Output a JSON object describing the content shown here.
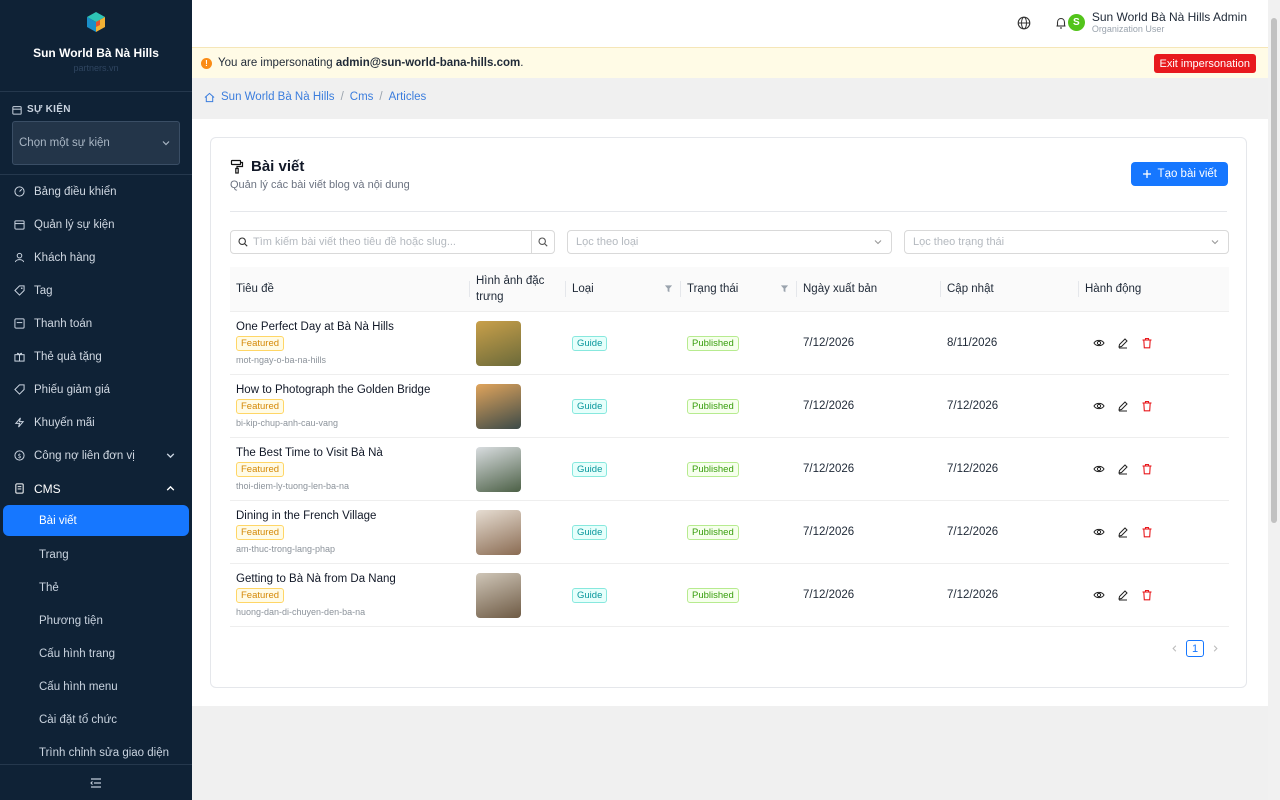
{
  "sidebar": {
    "org_name": "Sun World Bà Nà Hills",
    "org_sub": "partners.vn",
    "event_section_label": "SỰ KIỆN",
    "event_select_placeholder": "Chọn một sự kiện",
    "menu": [
      {
        "label": "Bảng điều khiển",
        "icon": "dashboard-icon"
      },
      {
        "label": "Quản lý sự kiện",
        "icon": "calendar-icon"
      },
      {
        "label": "Khách hàng",
        "icon": "user-icon"
      },
      {
        "label": "Tag",
        "icon": "tag-icon"
      },
      {
        "label": "Thanh toán",
        "icon": "payment-icon"
      },
      {
        "label": "Thẻ quà tặng",
        "icon": "gift-icon"
      },
      {
        "label": "Phiếu giảm giá",
        "icon": "coupon-icon"
      },
      {
        "label": "Khuyến mãi",
        "icon": "flash-icon"
      },
      {
        "label": "Công nợ liên đơn vị",
        "icon": "debt-icon"
      }
    ],
    "cms_label": "CMS",
    "cms_items": [
      "Bài viết",
      "Trang",
      "Thẻ",
      "Phương tiện",
      "Cấu hình trang",
      "Cấu hình menu",
      "Cài đặt tổ chức",
      "Trình chỉnh sửa giao diện"
    ],
    "active_item": "Bài viết"
  },
  "topbar": {
    "user_initial": "S",
    "user_name": "Sun World Bà Nà Hills Admin",
    "user_role": "Organization User"
  },
  "banner": {
    "prefix": "You are impersonating ",
    "email": "admin@sun-world-bana-hills.com",
    "suffix": ".",
    "exit_label": "Exit impersonation"
  },
  "breadcrumb": [
    "Sun World Bà Nà Hills",
    "Cms",
    "Articles"
  ],
  "page": {
    "title": "Bài viết",
    "subtitle": "Quản lý các bài viết blog và nội dung",
    "create_label": "Tạo bài viết",
    "search_placeholder": "Tìm kiếm bài viết theo tiêu đề hoặc slug...",
    "filter_type_placeholder": "Lọc theo loại",
    "filter_status_placeholder": "Lọc theo trạng thái"
  },
  "table": {
    "headers": [
      "Tiêu đề",
      "Hình ảnh đặc trưng",
      "Loại",
      "Trạng thái",
      "Ngày xuất bản",
      "Cập nhật",
      "Hành động"
    ],
    "rows": [
      {
        "title": "One Perfect Day at Bà Nà Hills",
        "featured": "Featured",
        "slug": "mot-ngay-o-ba-na-hills",
        "type": "Guide",
        "status": "Published",
        "published": "7/12/2026",
        "updated": "8/11/2026",
        "thumb": [
          "#c9a04a",
          "#6b6a3a"
        ]
      },
      {
        "title": "How to Photograph the Golden Bridge",
        "featured": "Featured",
        "slug": "bi-kip-chup-anh-cau-vang",
        "type": "Guide",
        "status": "Published",
        "published": "7/12/2026",
        "updated": "7/12/2026",
        "thumb": [
          "#e0a45c",
          "#3c4a48"
        ]
      },
      {
        "title": "The Best Time to Visit Bà Nà",
        "featured": "Featured",
        "slug": "thoi-diem-ly-tuong-len-ba-na",
        "type": "Guide",
        "status": "Published",
        "published": "7/12/2026",
        "updated": "7/12/2026",
        "thumb": [
          "#d9dde0",
          "#4c6046"
        ]
      },
      {
        "title": "Dining in the French Village",
        "featured": "Featured",
        "slug": "am-thuc-trong-lang-phap",
        "type": "Guide",
        "status": "Published",
        "published": "7/12/2026",
        "updated": "7/12/2026",
        "thumb": [
          "#e6ddd2",
          "#8a6b52"
        ]
      },
      {
        "title": "Getting to Bà Nà from Da Nang",
        "featured": "Featured",
        "slug": "huong-dan-di-chuyen-den-ba-na",
        "type": "Guide",
        "status": "Published",
        "published": "7/12/2026",
        "updated": "7/12/2026",
        "thumb": [
          "#cfc6b8",
          "#6e5a44"
        ]
      }
    ]
  },
  "pagination": {
    "current": "1"
  },
  "colors": {
    "primary": "#1677ff",
    "sidebar": "#0f2236",
    "danger": "#e8191d"
  }
}
